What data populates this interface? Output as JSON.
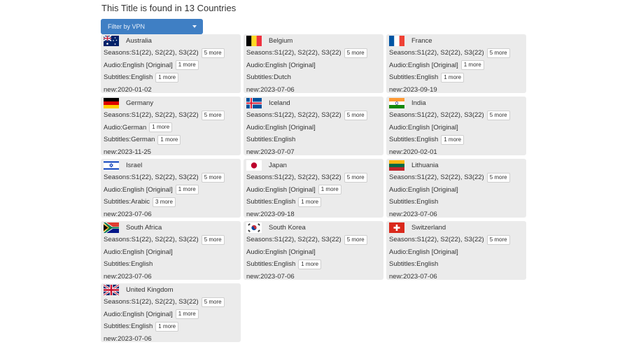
{
  "page_title": "This Title is found in 13 Countries",
  "vpn_filter": {
    "label": "Filter by VPN"
  },
  "countries": [
    {
      "name": "Australia",
      "flag": "flag-australia-icon",
      "seasons": "Seasons:S1(22), S2(22), S3(22)",
      "seasons_more": "5 more",
      "audio": "Audio:English [Original]",
      "audio_more": "1 more",
      "subtitles": "Subtitles:English",
      "subtitles_more": "1 more",
      "new": "new:2020-01-02"
    },
    {
      "name": "Belgium",
      "flag": "flag-belgium-icon",
      "seasons": "Seasons:S1(22), S2(22), S3(22)",
      "seasons_more": "5 more",
      "audio": "Audio:English [Original]",
      "audio_more": "",
      "subtitles": "Subtitles:Dutch",
      "subtitles_more": "",
      "new": "new:2023-07-06"
    },
    {
      "name": "France",
      "flag": "flag-france-icon",
      "seasons": "Seasons:S1(22), S2(22), S3(22)",
      "seasons_more": "5 more",
      "audio": "Audio:English [Original]",
      "audio_more": "1 more",
      "subtitles": "Subtitles:English",
      "subtitles_more": "1 more",
      "new": "new:2023-09-19"
    },
    {
      "name": "Germany",
      "flag": "flag-germany-icon",
      "seasons": "Seasons:S1(22), S2(22), S3(22)",
      "seasons_more": "5 more",
      "audio": "Audio:German",
      "audio_more": "1 more",
      "subtitles": "Subtitles:German",
      "subtitles_more": "1 more",
      "new": "new:2023-11-25"
    },
    {
      "name": "Iceland",
      "flag": "flag-iceland-icon",
      "seasons": "Seasons:S1(22), S2(22), S3(22)",
      "seasons_more": "5 more",
      "audio": "Audio:English [Original]",
      "audio_more": "",
      "subtitles": "Subtitles:English",
      "subtitles_more": "",
      "new": "new:2023-07-07"
    },
    {
      "name": "India",
      "flag": "flag-india-icon",
      "seasons": "Seasons:S1(22), S2(22), S3(22)",
      "seasons_more": "5 more",
      "audio": "Audio:English [Original]",
      "audio_more": "",
      "subtitles": "Subtitles:English",
      "subtitles_more": "1 more",
      "new": "new:2020-02-01"
    },
    {
      "name": "Israel",
      "flag": "flag-israel-icon",
      "seasons": "Seasons:S1(22), S2(22), S3(22)",
      "seasons_more": "5 more",
      "audio": "Audio:English [Original]",
      "audio_more": "1 more",
      "subtitles": "Subtitles:Arabic",
      "subtitles_more": "3 more",
      "new": "new:2023-07-06"
    },
    {
      "name": "Japan",
      "flag": "flag-japan-icon",
      "seasons": "Seasons:S1(22), S2(22), S3(22)",
      "seasons_more": "5 more",
      "audio": "Audio:English [Original]",
      "audio_more": "1 more",
      "subtitles": "Subtitles:English",
      "subtitles_more": "1 more",
      "new": "new:2023-09-18"
    },
    {
      "name": "Lithuania",
      "flag": "flag-lithuania-icon",
      "seasons": "Seasons:S1(22), S2(22), S3(22)",
      "seasons_more": "5 more",
      "audio": "Audio:English [Original]",
      "audio_more": "",
      "subtitles": "Subtitles:English",
      "subtitles_more": "",
      "new": "new:2023-07-06"
    },
    {
      "name": "South Africa",
      "flag": "flag-south-africa-icon",
      "seasons": "Seasons:S1(22), S2(22), S3(22)",
      "seasons_more": "5 more",
      "audio": "Audio:English [Original]",
      "audio_more": "",
      "subtitles": "Subtitles:English",
      "subtitles_more": "",
      "new": "new:2023-07-06"
    },
    {
      "name": "South Korea",
      "flag": "flag-south-korea-icon",
      "seasons": "Seasons:S1(22), S2(22), S3(22)",
      "seasons_more": "5 more",
      "audio": "Audio:English [Original]",
      "audio_more": "",
      "subtitles": "Subtitles:English",
      "subtitles_more": "1 more",
      "new": "new:2023-07-06"
    },
    {
      "name": "Switzerland",
      "flag": "flag-switzerland-icon",
      "seasons": "Seasons:S1(22), S2(22), S3(22)",
      "seasons_more": "5 more",
      "audio": "Audio:English [Original]",
      "audio_more": "",
      "subtitles": "Subtitles:English",
      "subtitles_more": "",
      "new": "new:2023-07-06"
    },
    {
      "name": "United Kingdom",
      "flag": "flag-united-kingdom-icon",
      "seasons": "Seasons:S1(22), S2(22), S3(22)",
      "seasons_more": "5 more",
      "audio": "Audio:English [Original]",
      "audio_more": "1 more",
      "subtitles": "Subtitles:English",
      "subtitles_more": "1 more",
      "new": "new:2023-07-06"
    }
  ]
}
